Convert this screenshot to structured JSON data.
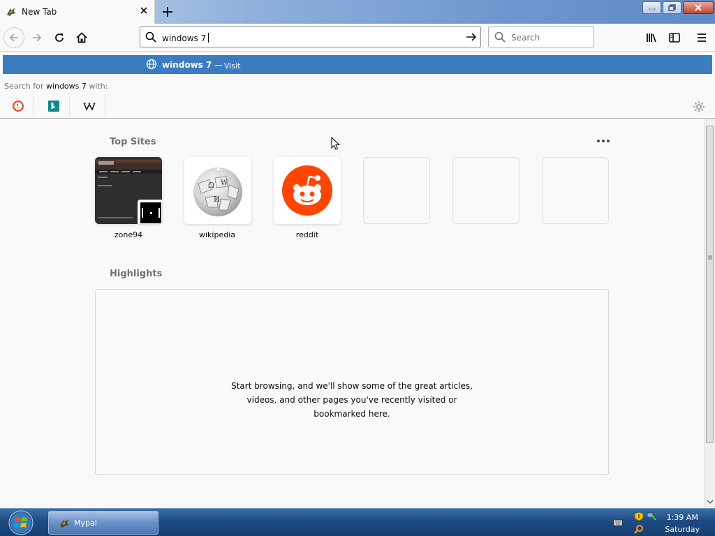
{
  "tab": {
    "title": "New Tab"
  },
  "urlbar": {
    "value": "windows 7"
  },
  "searchbar": {
    "placeholder": "Search"
  },
  "popup": {
    "suggestion_text": "windows 7",
    "suggestion_dash": "—",
    "suggestion_action": "Visit",
    "search_for_prefix": "Search for",
    "search_for_query": "windows 7",
    "search_for_suffix": "with:",
    "engines": [
      "DuckDuckGo",
      "Bing",
      "Wikipedia"
    ]
  },
  "top_sites": {
    "title": "Top Sites",
    "sites": [
      {
        "label": "zone94"
      },
      {
        "label": "wikipedia"
      },
      {
        "label": "reddit"
      }
    ]
  },
  "highlights": {
    "title": "Highlights",
    "empty_line1": "Start browsing, and we'll show some of the great articles,",
    "empty_line2": "videos, and other pages you've recently visited or",
    "empty_line3": "bookmarked here."
  },
  "taskbar": {
    "task_label": "Mypal",
    "time": "1:39 AM",
    "day": "Saturday"
  },
  "colors": {
    "accent": "#3b7bbf",
    "reddit": "#ff4500"
  }
}
